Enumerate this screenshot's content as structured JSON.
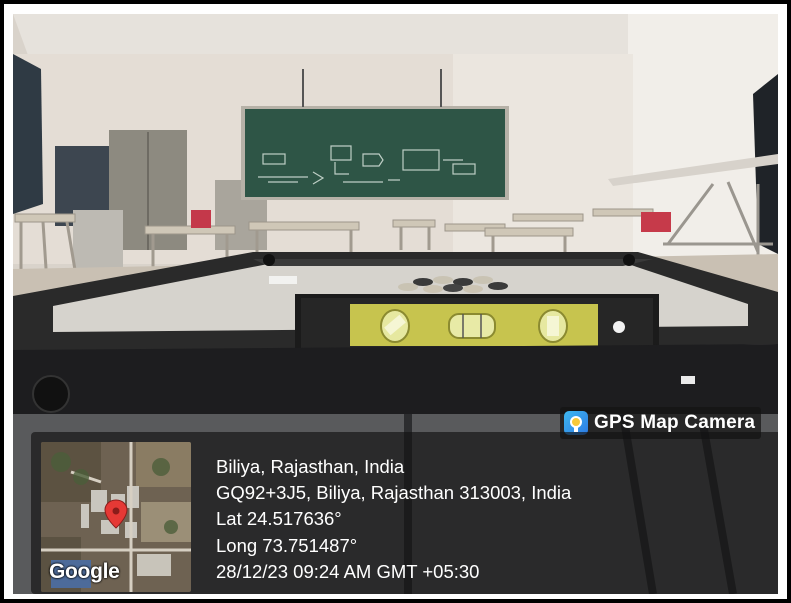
{
  "watermark": {
    "app_name": "GPS Map Camera",
    "app_icon": "gps-map-camera-icon",
    "map_attribution": "Google",
    "location_title": "Biliya, Rajasthan, India",
    "address": "GQ92+3J5, Biliya, Rajasthan 313003, India",
    "latitude": "Lat 24.517636°",
    "longitude": "Long 73.751487°",
    "datetime": "28/12/23 09:24 AM GMT +05:30",
    "colors": {
      "overlay": "#121212",
      "pin": "#e53935",
      "text": "#ffffff"
    }
  }
}
